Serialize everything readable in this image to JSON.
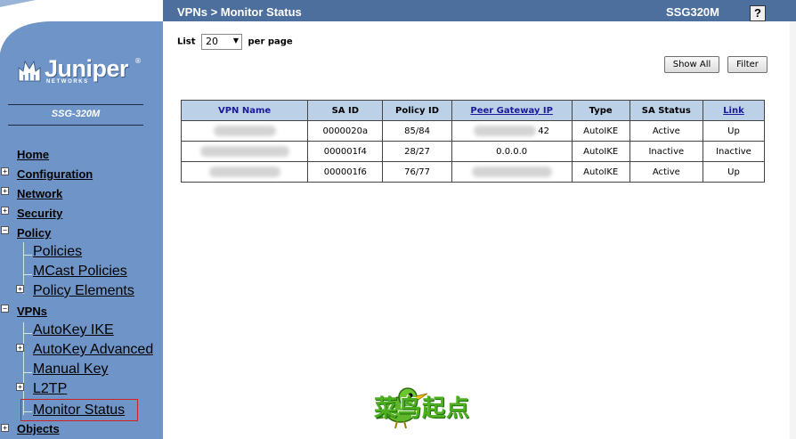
{
  "header": {
    "title": "VPNs > Monitor Status",
    "model": "SSG320M",
    "help_label": "?"
  },
  "brand": {
    "name": "Juniper",
    "sub": "NETWORKS",
    "reg": "®",
    "device": "SSG-320M"
  },
  "nav": {
    "home": "Home",
    "configuration": "Configuration",
    "network": "Network",
    "security": "Security",
    "policy": "Policy",
    "policies": "Policies",
    "mcast_policies": "MCast Policies",
    "policy_elements": "Policy Elements",
    "vpns": "VPNs",
    "autokey_ike": "AutoKey IKE",
    "autokey_advanced": "AutoKey Advanced",
    "manual_key": "Manual Key",
    "l2tp": "L2TP",
    "monitor_status": "Monitor Status",
    "objects": "Objects",
    "expand_symbol": "+",
    "collapse_symbol": "−"
  },
  "list": {
    "label_pre": "List",
    "value": "20",
    "label_post": "per page"
  },
  "buttons": {
    "show_all": "Show All",
    "filter": "Filter"
  },
  "table": {
    "headers": [
      "VPN Name",
      "SA ID",
      "Policy ID",
      "Peer Gateway IP",
      "Type",
      "SA Status",
      "Link"
    ],
    "rows": [
      {
        "name": "",
        "sa_id": "0000020a",
        "policy_id": "85/84",
        "peer_ip": "42",
        "type": "AutoIKE",
        "status": "Active",
        "link": "Up"
      },
      {
        "name": "",
        "sa_id": "000001f4",
        "policy_id": "28/27",
        "peer_ip": "0.0.0.0",
        "type": "AutoIKE",
        "status": "Inactive",
        "link": "Inactive"
      },
      {
        "name": "",
        "sa_id": "000001f6",
        "policy_id": "76/77",
        "peer_ip": "",
        "type": "AutoIKE",
        "status": "Active",
        "link": "Up"
      }
    ]
  },
  "watermark": {
    "text": "菜鸟起点"
  },
  "colors": {
    "sidebar": "#6f95c8",
    "header": "#4d6f9e",
    "table_header": "#bcd0e8",
    "accent_red": "#cc2222"
  }
}
